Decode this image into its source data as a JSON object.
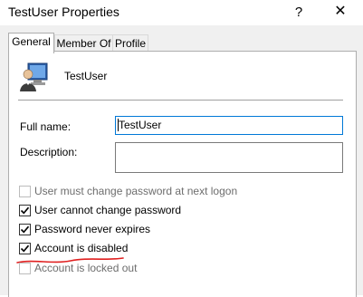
{
  "window": {
    "title": "TestUser Properties",
    "help_glyph": "?",
    "close_glyph": "✕"
  },
  "tabs": [
    {
      "label": "General",
      "active": true
    },
    {
      "label": "Member Of",
      "active": false
    },
    {
      "label": "Profile",
      "active": false
    }
  ],
  "general": {
    "user_name": "TestUser",
    "user_icon": "user-computer-icon",
    "full_name": {
      "label": "Full name:",
      "value": "TestUser"
    },
    "description": {
      "label": "Description:",
      "value": ""
    },
    "checkboxes": [
      {
        "label": "User must change password at next logon",
        "checked": false,
        "enabled": false
      },
      {
        "label": "User cannot change password",
        "checked": true,
        "enabled": true
      },
      {
        "label": "Password never expires",
        "checked": true,
        "enabled": true
      },
      {
        "label": "Account is disabled",
        "checked": true,
        "enabled": true
      },
      {
        "label": "Account is locked out",
        "checked": false,
        "enabled": false
      }
    ]
  },
  "colors": {
    "focus_border": "#0078d7",
    "annotation_underline": "#e02020"
  }
}
